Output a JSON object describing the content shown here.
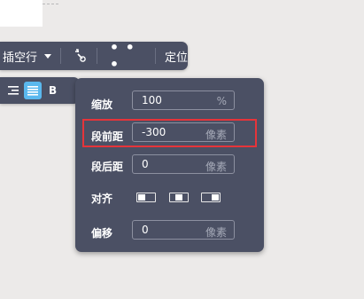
{
  "toolbar": {
    "insert_blank_line_label": "插空行",
    "dropdown_icon": "caret-down-icon",
    "clear_format_icon": "format-brush-icon",
    "more_icon": "more-dots-icon",
    "more_label": "• • •",
    "position_label": "定位"
  },
  "format_bar": {
    "bold_label": "B",
    "align_right_icon": "align-right-icon",
    "align_justify_icon": "align-justify-icon",
    "active_color": "#5ab8ee"
  },
  "paragraph_panel": {
    "scale": {
      "label": "缩放",
      "value": "100",
      "unit": "%"
    },
    "space_before": {
      "label": "段前距",
      "value": "-300",
      "unit": "像素"
    },
    "space_after": {
      "label": "段后距",
      "value": "0",
      "unit": "像素"
    },
    "align": {
      "label": "对齐",
      "options": [
        "align-left-icon",
        "align-center-icon",
        "align-right-icon"
      ]
    },
    "offset": {
      "label": "偏移",
      "value": "0",
      "unit": "像素"
    }
  },
  "colors": {
    "panel_bg": "#4b5064",
    "highlight_border": "#e6343a",
    "page_bg": "#eceae9"
  }
}
